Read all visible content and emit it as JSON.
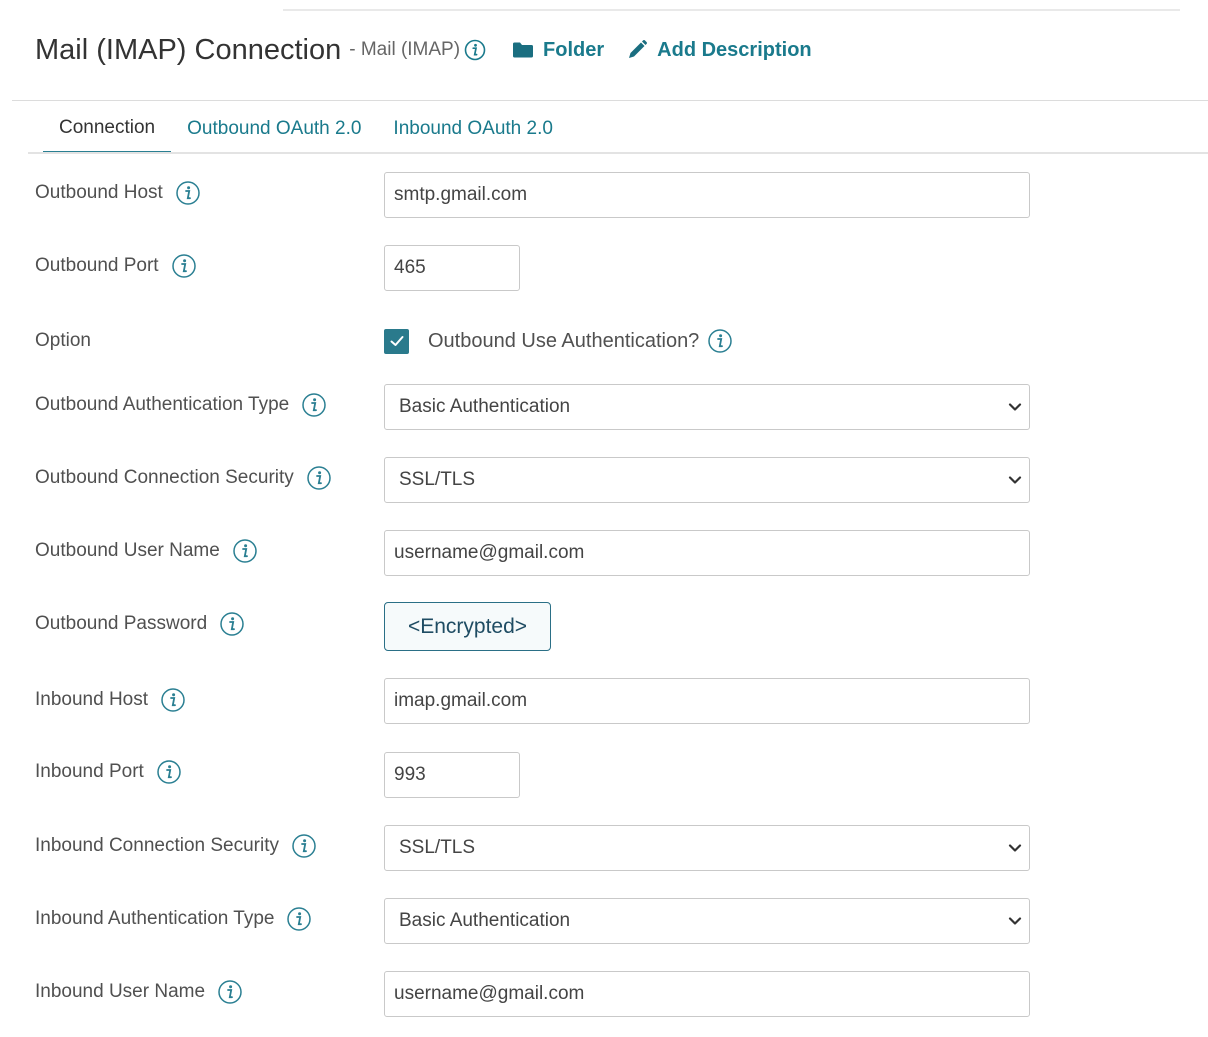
{
  "header": {
    "title": "Mail (IMAP) Connection",
    "subtitle": "- Mail (IMAP)",
    "folder_label": "Folder",
    "add_description_label": "Add Description"
  },
  "tabs": [
    {
      "label": "Connection",
      "active": true
    },
    {
      "label": "Outbound OAuth 2.0",
      "active": false
    },
    {
      "label": "Inbound OAuth 2.0",
      "active": false
    }
  ],
  "form": {
    "outbound_host": {
      "label": "Outbound Host",
      "value": "smtp.gmail.com"
    },
    "outbound_port": {
      "label": "Outbound Port",
      "value": "465"
    },
    "option": {
      "label": "Option",
      "checkbox_label": "Outbound Use Authentication?",
      "checked": true
    },
    "outbound_auth_type": {
      "label": "Outbound Authentication Type",
      "value": "Basic Authentication"
    },
    "outbound_conn_security": {
      "label": "Outbound Connection Security",
      "value": "SSL/TLS"
    },
    "outbound_user_name": {
      "label": "Outbound User Name",
      "value": "username@gmail.com"
    },
    "outbound_password": {
      "label": "Outbound Password",
      "button_label": "<Encrypted>"
    },
    "inbound_host": {
      "label": "Inbound Host",
      "value": "imap.gmail.com"
    },
    "inbound_port": {
      "label": "Inbound Port",
      "value": "993"
    },
    "inbound_conn_security": {
      "label": "Inbound Connection Security",
      "value": "SSL/TLS"
    },
    "inbound_auth_type": {
      "label": "Inbound Authentication Type",
      "value": "Basic Authentication"
    },
    "inbound_user_name": {
      "label": "Inbound User Name",
      "value": "username@gmail.com"
    }
  },
  "icons": {
    "info": "info-icon",
    "folder": "folder-icon",
    "pencil": "pencil-icon",
    "chevron": "chevron-down-icon",
    "check": "checkmark-icon"
  },
  "colors": {
    "accent": "#1a7a8c",
    "checkbox": "#2a7a8c",
    "tab_underline": "#2a7f92",
    "input_border": "#c9c9c9"
  }
}
